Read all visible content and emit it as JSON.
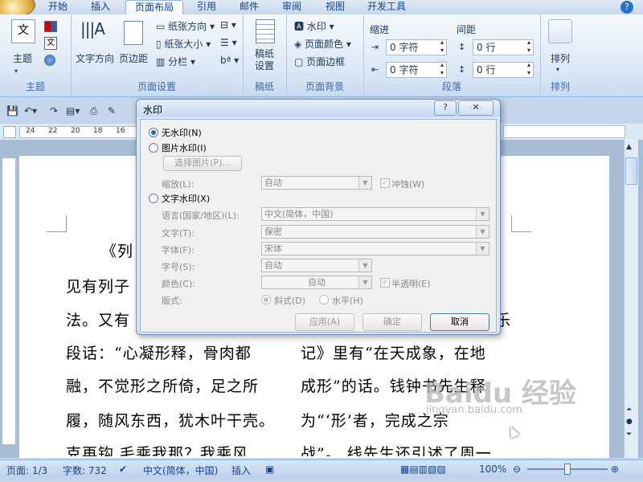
{
  "ribbon": {
    "tabs": [
      "开始",
      "插入",
      "页面布局",
      "引用",
      "邮件",
      "审阅",
      "视图",
      "开发工具"
    ],
    "active_tab": "页面布局",
    "groups": {
      "theme": {
        "label": "主题",
        "theme_button": "主题",
        "theme_letter": "文",
        "color": "A"
      },
      "page_setup": {
        "label": "页面设置",
        "text_direction": "文字方向",
        "margins": "页边距",
        "orientation": "纸张方向",
        "size": "纸张大小",
        "columns": "分栏"
      },
      "manuscript": {
        "label": "稿纸",
        "button": "稿纸\n设置"
      },
      "page_background": {
        "label": "页面背景",
        "watermark": "水印",
        "page_color": "页面颜色",
        "page_border": "页面边框"
      },
      "paragraph": {
        "label": "段落",
        "indent": "缩进",
        "spacing": "间距",
        "indent_left": "0 字符",
        "indent_right": "0 字符",
        "spacing_before": "0 行",
        "spacing_after": "0 行"
      },
      "arrange": {
        "label": "排列",
        "button": "排列"
      }
    }
  },
  "ruler": {
    "numbers": [
      "24",
      "22",
      "20",
      "18",
      "16"
    ]
  },
  "document": {
    "lines_left": [
      "《列",
      "见有列子",
      "法。又有",
      "段话：“心凝形释，骨肉都",
      "融，不觉形之所倚，足之所",
      "履，随风东西，犹木叶干壳。"
    ],
    "lines_right": [
      "乐",
      "记》里有“在天成象，在地",
      "成形”的话。钱钟书先生释",
      "为“‘形’者，完成之宗"
    ],
    "bottom_left": "克再钩 毛乘我那？我乘风",
    "bottom_right": "战”。 线先生还引述了周一"
  },
  "dialog": {
    "title": "水印",
    "help": "?",
    "close": "✕",
    "options": {
      "none": "无水印(N)",
      "picture": "图片水印(I)",
      "text": "文字水印(X)"
    },
    "select_picture": "选择图片(P)...",
    "scale_label": "缩放(L):",
    "scale_value": "自动",
    "washout_label": "冲蚀(W)",
    "language_label": "语言(国家/地区)(L):",
    "language_value": "中文(简体，中国)",
    "text_label": "文字(T):",
    "text_value": "保密",
    "font_label": "字体(F):",
    "font_value": "宋体",
    "size_label": "字号(S):",
    "size_value": "自动",
    "color_label": "颜色(C):",
    "color_value": "自动",
    "semitransparent_label": "半透明(E)",
    "layout_label": "版式:",
    "diagonal_label": "斜式(D)",
    "horizontal_label": "水平(H)",
    "apply": "应用(A)",
    "ok": "确定",
    "cancel": "取消"
  },
  "status": {
    "page": "页面: 1/3",
    "words": "字数: 732",
    "language": "中文(简体，中国)",
    "mode": "插入",
    "zoom": "100%"
  },
  "overlay": {
    "brand": "Baidu 经验",
    "url": "jingyan.baidu.com"
  },
  "colors": {
    "accent": "#15428b",
    "ribbon_bg": "#dbe7f5",
    "dialog_bg": "#dce8f6"
  }
}
